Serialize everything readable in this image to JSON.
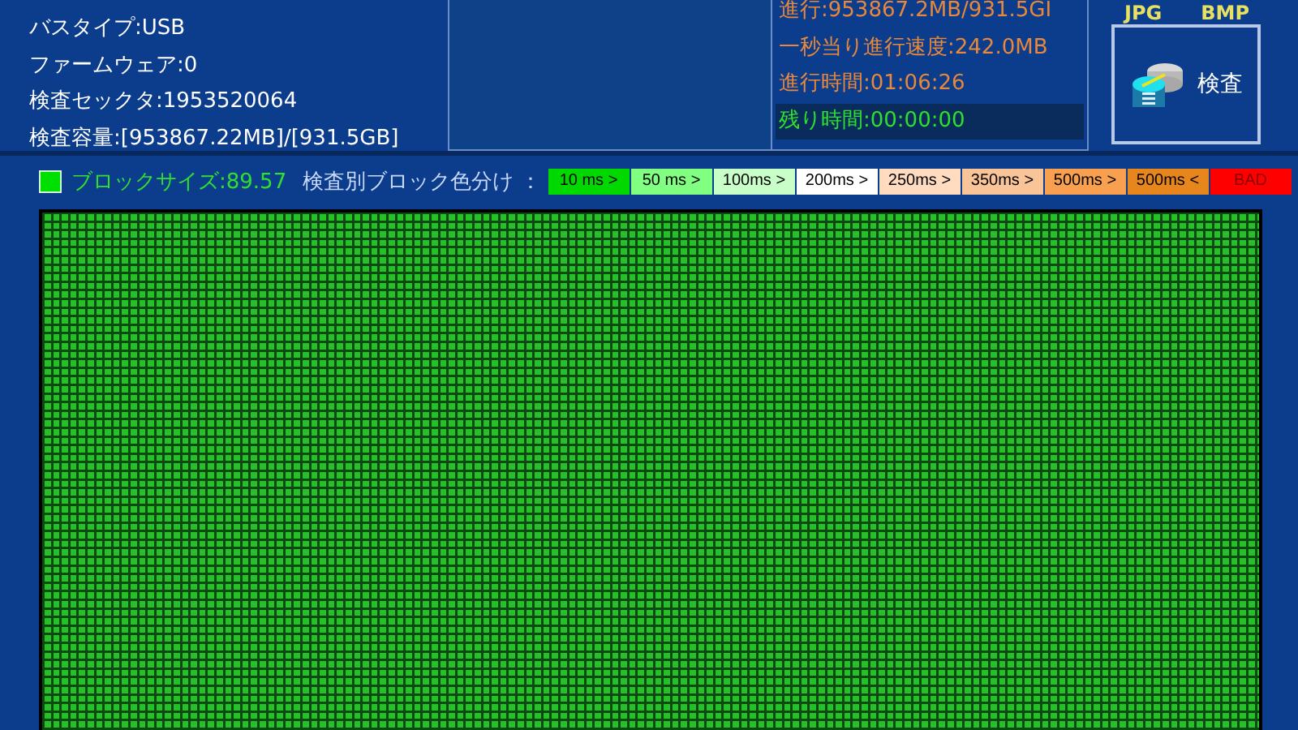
{
  "device_info": [
    "バスタイプ:USB",
    "ファームウェア:0",
    "検査セックタ:1953520064",
    "検査容量:[953867.22MB]/[931.5GB]"
  ],
  "progress": {
    "lines": [
      "進行:953867.2MB/931.5GI",
      "一秒当り進行速度:242.0MB",
      "進行時間:01:06:26"
    ],
    "remaining": "残り時間:00:00:00"
  },
  "export": [
    "JPG",
    "BMP"
  ],
  "scan_button": {
    "label": "検査"
  },
  "legend": {
    "block_size": "ブロックサイズ:89.57",
    "title": "検査別ブロック色分け ：",
    "items": [
      {
        "label": "10 ms >",
        "color": "#00d800"
      },
      {
        "label": "50 ms >",
        "color": "#80ff80"
      },
      {
        "label": "100ms >",
        "color": "#c8ffc8"
      },
      {
        "label": "200ms >",
        "color": "#ffffff"
      },
      {
        "label": "250ms >",
        "color": "#ffdcc0"
      },
      {
        "label": "350ms >",
        "color": "#f8c498"
      },
      {
        "label": "500ms >",
        "color": "#f8a050"
      },
      {
        "label": "500ms <",
        "color": "#e8861e"
      },
      {
        "label": "BAD",
        "color": "#ff0000"
      }
    ]
  }
}
